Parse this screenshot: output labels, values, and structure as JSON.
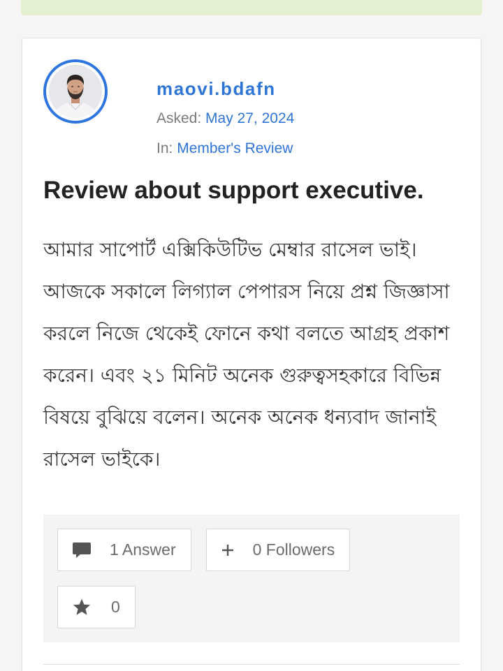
{
  "colors": {
    "page_background": "#f5f5f5",
    "notice_bar": "#e3f1d2",
    "accent": "#2f75d6",
    "avatar_ring": "#2f75e0",
    "muted_text": "#7a7a7a",
    "stats_background": "#f4f4f4",
    "icon": "#555555"
  },
  "question": {
    "author": {
      "username": "maovi.bdafn"
    },
    "asked_label": "Asked:",
    "asked_date": "May 27, 2024",
    "category_label": "In:",
    "category": "Member's Review",
    "title": "Review about support executive.",
    "body": "আমার সাপোর্ট এক্সিকিউটিভ মেম্বার রাসেল ভাই। আজকে সকালে লিগ্যাল পেপারস নিয়ে প্রশ্ন জিজ্ঞাসা করলে নিজে থেকেই ফোনে কথা বলতে আগ্রহ প্রকাশ করেন। এবং ২১ মিনিট অনেক গুরুত্বসহকারে বিভিন্ন বিষয়ে বুঝিয়ে বলেন। অনেক অনেক ধন্যবাদ জানাই রাসেল ভাইকে।"
  },
  "stats": {
    "answers": {
      "icon": "comment-icon",
      "label": "1 Answer"
    },
    "followers": {
      "icon": "plus-icon",
      "label": "0 Followers"
    },
    "favorites": {
      "icon": "star-icon",
      "label": "0"
    }
  }
}
